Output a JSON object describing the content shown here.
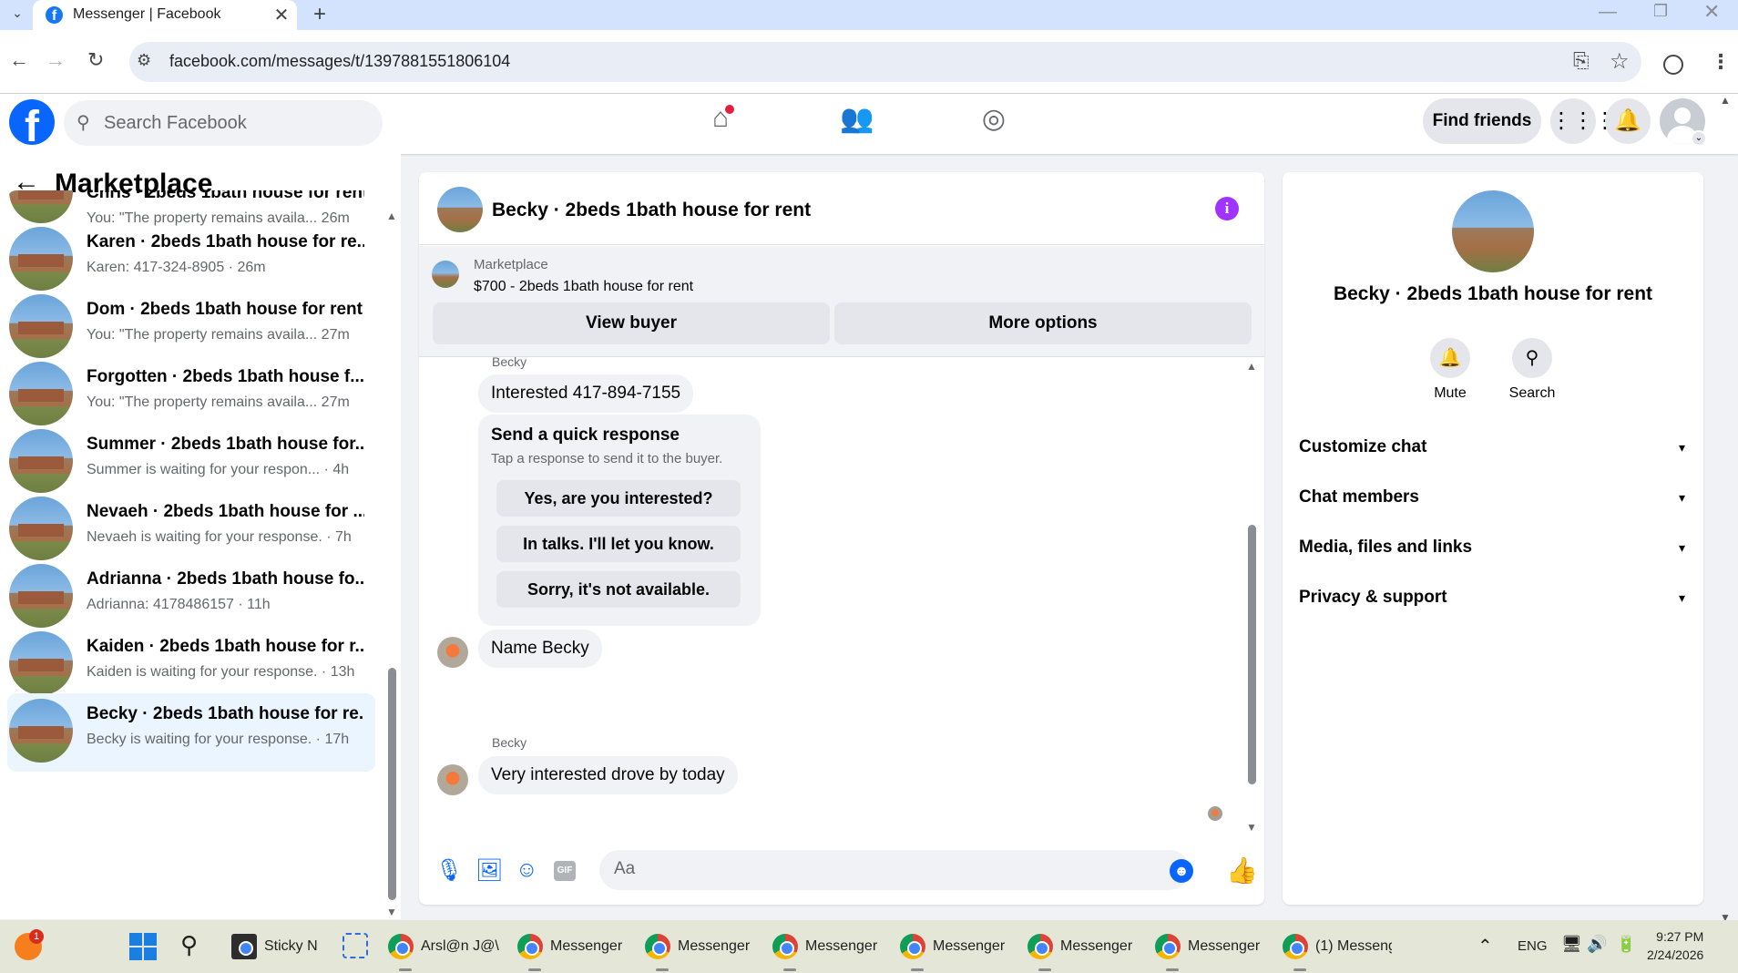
{
  "browser": {
    "tab_title": "Messenger | Facebook",
    "url": "facebook.com/messages/t/1397881551806104"
  },
  "fb": {
    "search_placeholder": "Search Facebook",
    "find_friends": "Find friends",
    "notification_dot_color": "#e41e3f",
    "brand_color": "#0866ff"
  },
  "sidebar": {
    "title": "Marketplace",
    "conversations": [
      {
        "name": "Chris · 2beds 1bath house for rent",
        "preview": "You: \"The property remains availa... 26m"
      },
      {
        "name": "Karen · 2beds 1bath house for re...",
        "preview": "Karen: 417-324-8905 · 26m"
      },
      {
        "name": "Dom · 2beds 1bath house for rent",
        "preview": "You: \"The property remains availa... 27m"
      },
      {
        "name": "Forgotten · 2beds 1bath house f...",
        "preview": "You: \"The property remains availa... 27m"
      },
      {
        "name": "Summer · 2beds 1bath house for...",
        "preview": "Summer is waiting for your respon... · 4h"
      },
      {
        "name": "Nevaeh · 2beds 1bath house for ...",
        "preview": "Nevaeh is waiting for your response. · 7h"
      },
      {
        "name": "Adrianna · 2beds 1bath house fo...",
        "preview": "Adrianna: 4178486157 · 11h"
      },
      {
        "name": "Kaiden · 2beds 1bath house for r...",
        "preview": "Kaiden is waiting for your response. · 13h"
      },
      {
        "name": "Becky · 2beds 1bath house for re...",
        "preview": "Becky is waiting for your response. · 17h"
      }
    ]
  },
  "chat": {
    "title": "Becky · 2beds 1bath house for rent",
    "marketplace_label": "Marketplace",
    "listing": "$700 - 2beds 1bath house for rent",
    "view_buyer": "View buyer",
    "more_options": "More options",
    "sender1": "Becky",
    "msg1": "Interested 417-894-7155",
    "quick_title": "Send a quick response",
    "quick_sub": "Tap a response to send it to the buyer.",
    "quick_options": [
      "Yes, are you interested?",
      "In talks. I'll let you know.",
      "Sorry, it's not available."
    ],
    "msg2": "Name Becky",
    "sender2": "Becky",
    "msg3": "Very interested drove by today",
    "compose_placeholder": "Aa",
    "accent_color": "#a033ff"
  },
  "info_panel": {
    "title": "Becky · 2beds 1bath house for rent",
    "mute": "Mute",
    "search": "Search",
    "sections": [
      "Customize chat",
      "Chat members",
      "Media, files and links",
      "Privacy & support"
    ]
  },
  "taskbar": {
    "badge": "1",
    "sticky": "Sticky N",
    "items": [
      "Arsl@n J@\\",
      "Messenger",
      "Messenger",
      "Messenger",
      "Messenger",
      "Messenger",
      "Messenger",
      "(1) Messeng"
    ],
    "lang": "ENG",
    "time": "9:27 PM",
    "date": "2/24/2026"
  }
}
